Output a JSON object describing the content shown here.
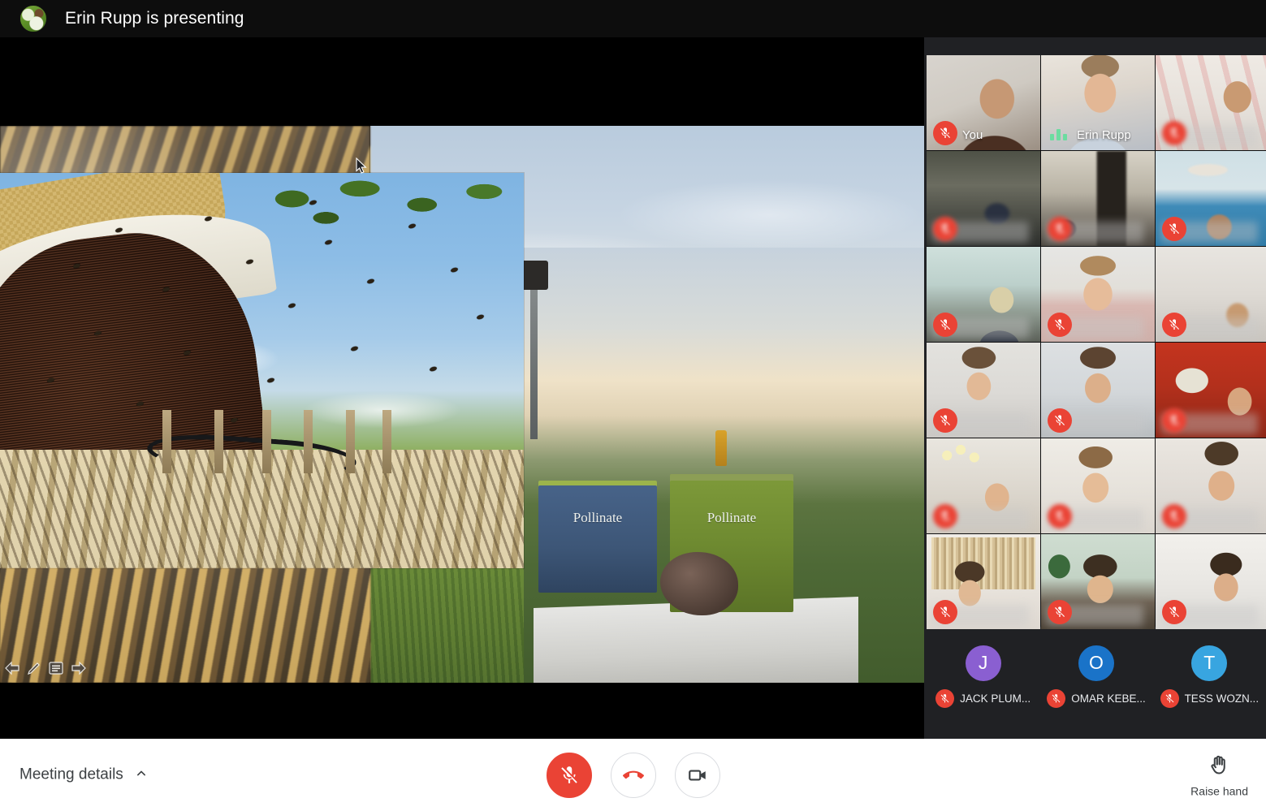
{
  "topbar": {
    "presenting_text": "Erin Rupp is presenting",
    "avatar_name": "presenter-avatar-bee-flower"
  },
  "slide": {
    "hive_label_left": "Pollinate",
    "hive_label_right": "Pollinate",
    "toolbar": {
      "back_label": "back-arrow-icon",
      "pen_label": "pen-icon",
      "menu_label": "menu-icon",
      "forward_label": "forward-arrow-icon"
    }
  },
  "rail": {
    "tiles": [
      {
        "label": "You",
        "blurred": false,
        "mic_off": true,
        "speaking": false,
        "mic_blur": false
      },
      {
        "label": "Erin Rupp",
        "blurred": false,
        "mic_off": false,
        "speaking": true,
        "mic_blur": false
      },
      {
        "label": "",
        "blurred": true,
        "mic_off": true,
        "speaking": false,
        "mic_blur": true
      },
      {
        "label": "",
        "blurred": true,
        "mic_off": true,
        "speaking": false,
        "mic_blur": true
      },
      {
        "label": "",
        "blurred": true,
        "mic_off": true,
        "speaking": false,
        "mic_blur": true
      },
      {
        "label": "",
        "blurred": true,
        "mic_off": true,
        "speaking": false,
        "mic_blur": false
      },
      {
        "label": "",
        "blurred": true,
        "mic_off": true,
        "speaking": false,
        "mic_blur": false
      },
      {
        "label": "",
        "blurred": true,
        "mic_off": true,
        "speaking": false,
        "mic_blur": true
      },
      {
        "label": "",
        "blurred": true,
        "mic_off": true,
        "speaking": false,
        "mic_blur": true
      },
      {
        "label": "",
        "blurred": true,
        "mic_off": true,
        "speaking": false,
        "mic_blur": true
      },
      {
        "label": "",
        "blurred": true,
        "mic_off": true,
        "speaking": false,
        "mic_blur": true
      },
      {
        "label": "",
        "blurred": true,
        "mic_off": true,
        "speaking": false,
        "mic_blur": true
      },
      {
        "label": "",
        "blurred": true,
        "mic_off": true,
        "speaking": false,
        "mic_blur": false
      },
      {
        "label": "",
        "blurred": true,
        "mic_off": true,
        "speaking": false,
        "mic_blur": true
      },
      {
        "label": "",
        "blurred": true,
        "mic_off": true,
        "speaking": false,
        "mic_blur": false
      },
      {
        "label": "",
        "blurred": true,
        "mic_off": true,
        "speaking": false,
        "mic_blur": false
      },
      {
        "label": "",
        "blurred": true,
        "mic_off": true,
        "speaking": false,
        "mic_blur": false
      },
      {
        "label": "",
        "blurred": true,
        "mic_off": true,
        "speaking": false,
        "mic_blur": false
      }
    ],
    "avatar_participants": [
      {
        "initial": "J",
        "name": "JACK PLUM...",
        "color": "#8a5fd1",
        "mic_off": true
      },
      {
        "initial": "O",
        "name": "OMAR KEBE...",
        "color": "#1a73c8",
        "mic_off": true
      },
      {
        "initial": "T",
        "name": "TESS WOZN...",
        "color": "#38a5e0",
        "mic_off": true
      }
    ]
  },
  "bottombar": {
    "meeting_details_label": "Meeting details",
    "meeting_details_chevron": "chevron-up-icon",
    "mic_button": {
      "name": "mic-off-button",
      "state": "muted"
    },
    "end_call_button": {
      "name": "end-call-button"
    },
    "camera_button": {
      "name": "camera-button"
    },
    "raise_hand_label": "Raise hand"
  },
  "colors": {
    "accent_red": "#ea4335",
    "speaking_green": "#6cdca0",
    "rail_bg": "#202124",
    "topbar_bg": "#0d0d0d",
    "bottombar_bg": "#ffffff",
    "text_dark": "#3c4043"
  }
}
